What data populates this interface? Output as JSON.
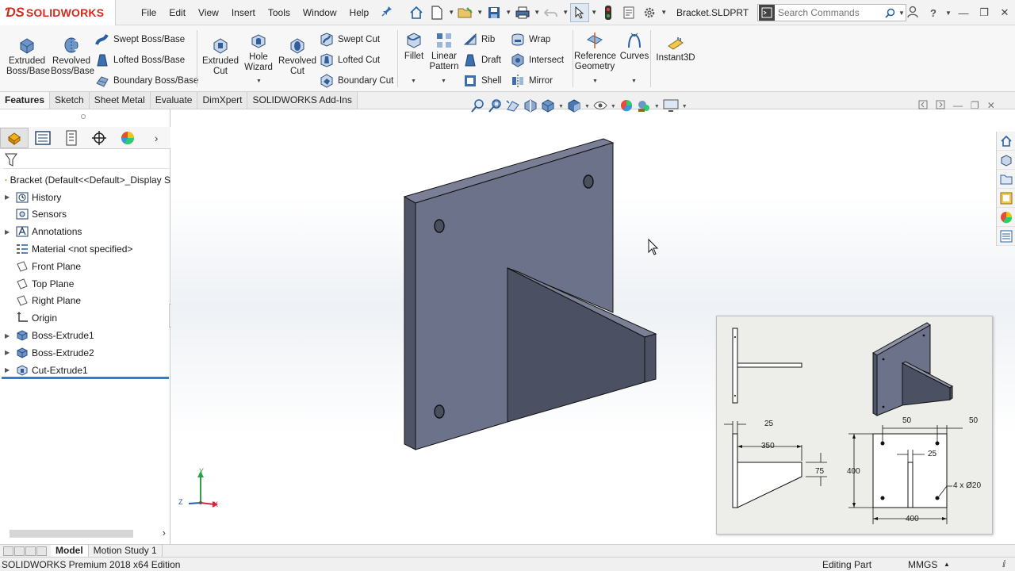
{
  "app": {
    "logo_text": "SOLIDWORKS",
    "doc_title": "Bracket.SLDPRT",
    "accent": "#d52b1e",
    "icon_blue": "#2f6db5"
  },
  "menu": [
    "File",
    "Edit",
    "View",
    "Insert",
    "Tools",
    "Window",
    "Help"
  ],
  "search": {
    "placeholder": "Search Commands"
  },
  "commands": {
    "extruded_boss": "Extruded\nBoss/Base",
    "revolved_boss": "Revolved\nBoss/Base",
    "swept_boss": "Swept Boss/Base",
    "lofted_boss": "Lofted Boss/Base",
    "boundary_boss": "Boundary Boss/Base",
    "extruded_cut": "Extruded\nCut",
    "hole_wizard": "Hole\nWizard",
    "revolved_cut": "Revolved\nCut",
    "swept_cut": "Swept Cut",
    "lofted_cut": "Lofted Cut",
    "boundary_cut": "Boundary Cut",
    "fillet": "Fillet",
    "linear_pattern": "Linear\nPattern",
    "rib": "Rib",
    "draft": "Draft",
    "shell": "Shell",
    "wrap": "Wrap",
    "intersect": "Intersect",
    "mirror": "Mirror",
    "reference_geometry": "Reference\nGeometry",
    "curves": "Curves",
    "instant3d": "Instant3D"
  },
  "tabs": [
    "Features",
    "Sketch",
    "Sheet Metal",
    "Evaluate",
    "DimXpert",
    "SOLIDWORKS Add-Ins"
  ],
  "tree": {
    "root": "Bracket  (Default<<Default>_Display S",
    "items": [
      {
        "label": "History",
        "expandable": true
      },
      {
        "label": "Sensors",
        "expandable": false
      },
      {
        "label": "Annotations",
        "expandable": true
      },
      {
        "label": "Material <not specified>",
        "expandable": false
      },
      {
        "label": "Front Plane",
        "expandable": false
      },
      {
        "label": "Top Plane",
        "expandable": false
      },
      {
        "label": "Right Plane",
        "expandable": false
      },
      {
        "label": "Origin",
        "expandable": false
      },
      {
        "label": "Boss-Extrude1",
        "expandable": true
      },
      {
        "label": "Boss-Extrude2",
        "expandable": true
      },
      {
        "label": "Cut-Extrude1",
        "expandable": true
      }
    ]
  },
  "bottom_tabs": [
    "Model",
    "Motion Study 1"
  ],
  "status": {
    "edition": "SOLIDWORKS Premium 2018 x64 Edition",
    "mode": "Editing Part",
    "units": "MMGS"
  },
  "triad": {
    "y": "Y",
    "z": "Z",
    "x": "X"
  },
  "drawing": {
    "dim_25_thk": "25",
    "dim_350": "350",
    "dim_75": "75",
    "dim_400_h": "400",
    "dim_400_w": "400",
    "dim_50_left": "50",
    "dim_50_right": "50",
    "dim_25_slot": "25",
    "hole_note": "4 x Ø20"
  }
}
